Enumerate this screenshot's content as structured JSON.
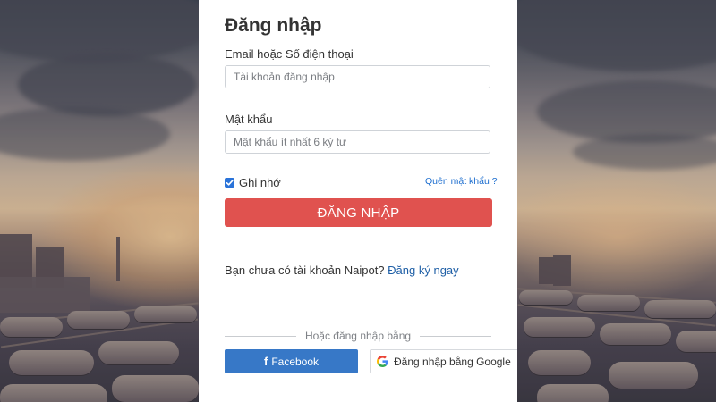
{
  "login": {
    "title": "Đăng nhập",
    "email_label": "Email hoặc Số điện thoại",
    "email_placeholder": "Tài khoản đăng nhập",
    "email_value": "",
    "password_label": "Mật khẩu",
    "password_placeholder": "Mật khẩu ít nhất 6 ký tự",
    "password_value": "",
    "remember_label": "Ghi nhớ",
    "remember_checked": true,
    "forgot_label": "Quên mật khẩu ?",
    "submit_label": "ĐĂNG NHẬP",
    "signup_prompt": "Bạn chưa có tài khoản Naipot?",
    "signup_link": "Đăng ký ngay",
    "alt_login_text": "Hoặc đăng nhập bằng",
    "facebook_label": "Facebook",
    "google_label": "Đăng nhập bằng Google"
  },
  "colors": {
    "primary_button": "#e0524f",
    "facebook": "#3778c7",
    "link": "#1f6fcf",
    "checkbox": "#2a73d9"
  },
  "icons": {
    "facebook": "facebook-icon",
    "google": "google-icon",
    "checkbox": "check-icon"
  }
}
